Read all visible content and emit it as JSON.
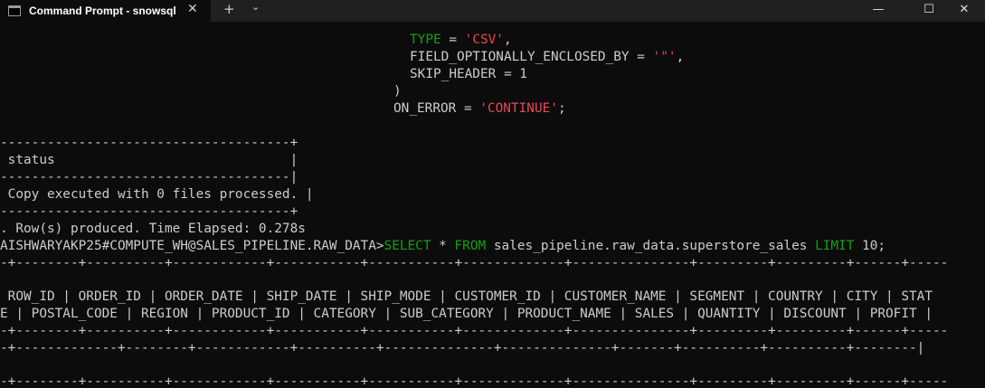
{
  "window": {
    "tab_title": "Command Prompt - snowsql",
    "icons": {
      "tab": "terminal-icon",
      "close_tab": "close-icon",
      "new_tab": "plus-icon",
      "dropdown": "chevron-down-icon",
      "minimize": "minimize-icon",
      "maximize": "maximize-icon",
      "close": "close-icon"
    },
    "glyphs": {
      "close_tab": "✕",
      "new_tab": "+",
      "dropdown": "⌄",
      "minimize": "—",
      "maximize": "☐",
      "close": "✕"
    }
  },
  "terminal": {
    "colors": {
      "background": "#0c0c0c",
      "text": "#cccccc",
      "keyword": "#13a10e",
      "string": "#e74856"
    },
    "lines": {
      "type_kw": "TYPE",
      "type_eq": " = ",
      "type_val": "'CSV'",
      "type_comma": ",",
      "foeb_kw": "FIELD_OPTIONALLY_ENCLOSED_BY",
      "foeb_eq": " = ",
      "foeb_val": "'\"'",
      "foeb_comma": ",",
      "skip_header": "SKIP_HEADER = 1",
      "close_paren": ")",
      "on_error_kw": "ON_ERROR = ",
      "on_error_val": "'CONTINUE'",
      "on_error_end": ";",
      "status_border_top": "-------------------------------------+",
      "status_header": " status                              |",
      "status_sep": "-------------------------------------|",
      "status_row": " Copy executed with 0 files processed. |",
      "status_border_bottom": "-------------------------------------+",
      "rows_produced": ". Row(s) produced. Time Elapsed: 0.278s",
      "prompt": "AISHWARYAKP25#COMPUTE_WH@SALES_PIPELINE.RAW_DATA>",
      "query_select": "SELECT",
      "query_star": " * ",
      "query_from": "FROM",
      "query_table": " sales_pipeline.raw_data.superstore_sales ",
      "query_limit": "LIMIT",
      "query_end": " 10;",
      "result_border_top": "-+--------+----------+------------+-----------+-----------+-------------+---------------+---------+---------+------+-----",
      "result_header_1": " ROW_ID | ORDER_ID | ORDER_DATE | SHIP_DATE | SHIP_MODE | CUSTOMER_ID | CUSTOMER_NAME | SEGMENT | COUNTRY | CITY | STAT",
      "result_header_2": "E | POSTAL_CODE | REGION | PRODUCT_ID | CATEGORY | SUB_CATEGORY | PRODUCT_NAME | SALES | QUANTITY | DISCOUNT | PROFIT |",
      "result_border_mid": "-+--------+----------+------------+-----------+-----------+-------------+---------------+---------+---------+------+-----",
      "result_border_2": "-+-------------+--------+------------+----------+--------------+--------------+-------+----------+----------+--------|",
      "result_border_bottom": "-+--------+----------+------------+-----------+-----------+-------------+---------------+---------+---------+------+-----"
    }
  }
}
